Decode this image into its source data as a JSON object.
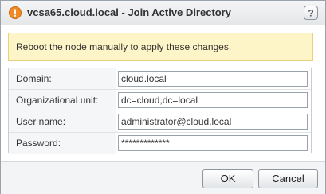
{
  "dialog": {
    "title": "vcsa65.cloud.local - Join Active Directory",
    "help_symbol": "?"
  },
  "alert": {
    "message": "Reboot the node manually to apply these changes."
  },
  "form": {
    "fields": [
      {
        "label": "Domain:",
        "value": "cloud.local"
      },
      {
        "label": "Organizational unit:",
        "value": "dc=cloud,dc=local"
      },
      {
        "label": "User name:",
        "value": "administrator@cloud.local"
      },
      {
        "label": "Password:",
        "value": "*************"
      }
    ]
  },
  "footer": {
    "ok_label": "OK",
    "cancel_label": "Cancel"
  },
  "icons": {
    "title": "warning-icon",
    "help": "help-icon"
  },
  "colors": {
    "warning_icon": "#f08a24",
    "alert_background": "#fdf5c7",
    "alert_border": "#e8d17a"
  }
}
